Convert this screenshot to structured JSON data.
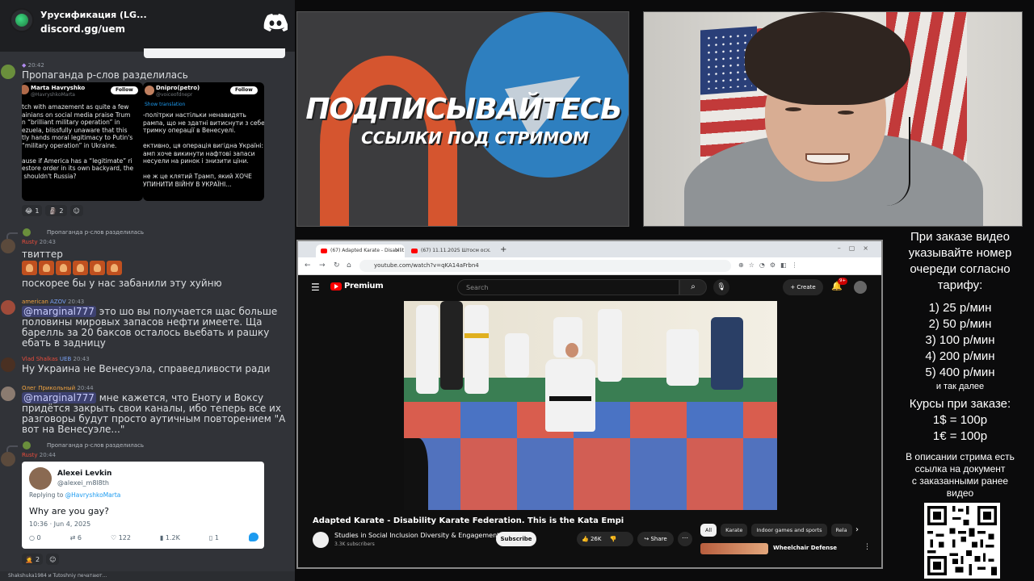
{
  "chat": {
    "server_name": "Урусификация (LG...",
    "server_link": "discord.gg/uem",
    "messages": {
      "m1": {
        "time": "20:42",
        "text": "Пропаганда р-слов разделилась",
        "tweet_left": {
          "name": "Marta Havryshko",
          "handle": "@HavryshkoMarta",
          "follow": "Follow",
          "body": "tch with amazement as quite a few\nainians on social media praise Trum\nn “brilliant military operation” in\nezuela, blissfully unaware that this\ntly hands moral legitimacy to Putin's\n“military operation” in Ukraine.\n\nause if America has a “legitimate” ri\nestore order in its own backyard, the\n shouldn't Russia?"
        },
        "tweet_right": {
          "name": "Dnipro(petro)",
          "handle": "@voiceofdnepr",
          "follow": "Follow",
          "translate": "Show translation",
          "body": "-політрки настільки ненавидять\nрампа, що не здатні витиснути з себе\nтримку операції в Венесуелі.\n\nективно, ця операція вигідна Україні:\nамп хоче викинути нафтові запаси\nнесуели на ринок і знизити ціни.\n\nне ж це клятий Трамп, який ХОЧЕ\nУПИНИТИ ВІЙНУ В УКРАЇНІ..."
        },
        "reactions": [
          {
            "emoji": "😂",
            "count": "1"
          },
          {
            "emoji": "🗿",
            "count": "2"
          }
        ]
      },
      "m2": {
        "reply_to": "Пропаганда р-слов разделилась",
        "user": "Rusty",
        "time": "20:43",
        "line1": "твиттер",
        "line2": "поскорее бы у нас забанили эту хуйню"
      },
      "m3": {
        "user": "american",
        "tag": "AZOV",
        "time": "20:43",
        "mention": "@marginal777",
        "text": " это шо вы получается щас больше половины мировых запасов нефти имеете. Ща барелль за 20 баксов осталось вьебать и рашку ебать в задницу"
      },
      "m4": {
        "user": "Vlad Shalkas",
        "tags": "UEB",
        "time": "20:43",
        "text": "Ну Украина не Венесуэла, справедливости ради"
      },
      "m5": {
        "user": "Олег Прикольный",
        "time": "20:44",
        "mention": "@marginal777",
        "text": " мне кажется, что Еноту и Воксу придётся закрыть свои каналы, ибо теперь все их разговоры будут просто аутичным повторением \"А вот на Венесуэле...\""
      },
      "m6": {
        "reply_to": "Пропаганда р-слов разделилась",
        "user": "Rusty",
        "time": "20:44",
        "tweet": {
          "name": "Alexei Levkin",
          "handle": "@alexei_m8l8th",
          "replying_prefix": "Replying to ",
          "replying_to": "@HavryshkoMarta",
          "body": "Why are you gay?",
          "time": "10:36 · Jun 4, 2025",
          "stats": {
            "replies": "0",
            "retweets": "6",
            "likes": "122",
            "views": "1.2K",
            "bookmarks": "1"
          }
        },
        "reactions": [
          {
            "emoji": "🤦",
            "count": "2"
          }
        ]
      }
    },
    "typing": "Shakshuka1984 и Tutoshniy печатают..."
  },
  "banner": {
    "title": "ПОДПИСЫВАЙТЕСЬ",
    "subtitle": "ССЫЛКИ ПОД СТРИМОМ"
  },
  "browser": {
    "tabs": [
      {
        "label": "(67) Adapted Karate - Disabilit"
      },
      {
        "label": "(67) 11.11.2025 Штосм ос..."
      }
    ],
    "url": "youtube.com/watch?v=qKA14aFrbn4",
    "youtube": {
      "brand": "Premium",
      "search_placeholder": "Search",
      "create": "Create",
      "notif_count": "9+",
      "video_title": "Adapted Karate - Disability Karate Federation. This is the Kata Empi",
      "channel": "Studies in Social Inclusion Diversity & Engagement",
      "subscribers": "3.3K subscribers",
      "subscribe": "Subscribe",
      "likes": "26K",
      "share": "Share",
      "chips": [
        "All",
        "Karate",
        "Indoor games and sports",
        "Rela"
      ],
      "rec_title": "Wheelchair Defense"
    }
  },
  "info": {
    "l1": "При заказе видео",
    "l2": "указывайте номер",
    "l3": "очереди согласно",
    "l4": "тарифу:",
    "p1": "1) 25 р/мин",
    "p2": "2) 50 р/мин",
    "p3": "3) 100 р/мин",
    "p4": "4) 200 р/мин",
    "p5": "5) 400 р/мин",
    "etc": "и так далее",
    "c1": "Курсы при заказе:",
    "c2": "1$ = 100р",
    "c3": "1€ = 100р",
    "d1": "В описании стрима есть",
    "d2": "ссылка на документ",
    "d3": "с заказанными ранее",
    "d4": "видео"
  }
}
